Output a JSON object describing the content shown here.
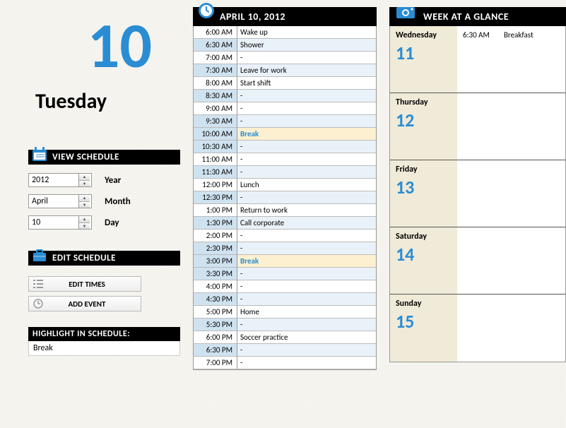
{
  "left": {
    "bignum": "10",
    "dayname": "Tuesday",
    "view_label": "VIEW SCHEDULE",
    "year_val": "2012",
    "year_lbl": "Year",
    "month_val": "April",
    "month_lbl": "Month",
    "day_val": "10",
    "day_lbl": "Day",
    "edit_label": "EDIT SCHEDULE",
    "btn_times": "EDIT TIMES",
    "btn_add": "ADD EVENT",
    "hl_label": "HIGHLIGHT IN SCHEDULE:",
    "hl_val": "Break"
  },
  "mid": {
    "title": "APRIL 10, 2012",
    "rows": [
      {
        "t": "6:00 AM",
        "v": "Wake up",
        "alt": 0
      },
      {
        "t": "6:30 AM",
        "v": "Shower",
        "alt": 1
      },
      {
        "t": "7:00 AM",
        "v": "-",
        "alt": 0
      },
      {
        "t": "7:30 AM",
        "v": "Leave for work",
        "alt": 1
      },
      {
        "t": "8:00 AM",
        "v": "Start shift",
        "alt": 0
      },
      {
        "t": "8:30 AM",
        "v": "-",
        "alt": 1
      },
      {
        "t": "9:00 AM",
        "v": "-",
        "alt": 0
      },
      {
        "t": "9:30 AM",
        "v": "-",
        "alt": 1
      },
      {
        "t": "10:00 AM",
        "v": "Break",
        "alt": 0,
        "hl": 1
      },
      {
        "t": "10:30 AM",
        "v": "-",
        "alt": 1
      },
      {
        "t": "11:00 AM",
        "v": "-",
        "alt": 0
      },
      {
        "t": "11:30 AM",
        "v": "-",
        "alt": 1
      },
      {
        "t": "12:00 PM",
        "v": "Lunch",
        "alt": 0
      },
      {
        "t": "12:30 PM",
        "v": "-",
        "alt": 1
      },
      {
        "t": "1:00 PM",
        "v": "Return to work",
        "alt": 0
      },
      {
        "t": "1:30 PM",
        "v": "Call corporate",
        "alt": 1
      },
      {
        "t": "2:00 PM",
        "v": "-",
        "alt": 0
      },
      {
        "t": "2:30 PM",
        "v": "-",
        "alt": 1
      },
      {
        "t": "3:00 PM",
        "v": "Break",
        "alt": 0,
        "hl": 1
      },
      {
        "t": "3:30 PM",
        "v": "-",
        "alt": 1
      },
      {
        "t": "4:00 PM",
        "v": "-",
        "alt": 0
      },
      {
        "t": "4:30 PM",
        "v": "-",
        "alt": 1
      },
      {
        "t": "5:00 PM",
        "v": "Home",
        "alt": 0
      },
      {
        "t": "5:30 PM",
        "v": "-",
        "alt": 1
      },
      {
        "t": "6:00 PM",
        "v": "Soccer practice",
        "alt": 0
      },
      {
        "t": "6:30 PM",
        "v": "-",
        "alt": 1
      },
      {
        "t": "7:00 PM",
        "v": "-",
        "alt": 0
      }
    ]
  },
  "right": {
    "title": "WEEK AT A GLANCE",
    "days": [
      {
        "name": "Wednesday",
        "num": "11",
        "evt": "6:30 AM",
        "evv": "Breakfast"
      },
      {
        "name": "Thursday",
        "num": "12",
        "evt": "",
        "evv": ""
      },
      {
        "name": "Friday",
        "num": "13",
        "evt": "",
        "evv": ""
      },
      {
        "name": "Saturday",
        "num": "14",
        "evt": "",
        "evv": ""
      },
      {
        "name": "Sunday",
        "num": "15",
        "evt": "",
        "evv": ""
      }
    ]
  }
}
